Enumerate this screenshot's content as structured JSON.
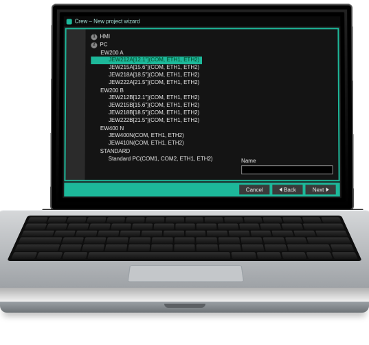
{
  "window": {
    "title": "Crew – New project wizard"
  },
  "steps": [
    {
      "num": "1",
      "label": "HMI"
    },
    {
      "num": "2",
      "label": "PC"
    }
  ],
  "tree": [
    {
      "group": "EW200 A",
      "items": [
        "JEW212A[12.1\"](COM, ETH1, ETH2)",
        "JEW215A[15.6\"](COM, ETH1, ETH2)",
        "JEW218A[18.5\"](COM, ETH1, ETH2)",
        "JEW222A[21.5\"](COM, ETH1, ETH2)"
      ],
      "selected": 0
    },
    {
      "group": "EW200 B",
      "items": [
        "JEW212B[12.1\"](COM, ETH1, ETH2)",
        "JEW215B[15.6\"](COM, ETH1, ETH2)",
        "JEW218B[18.5\"](COM, ETH1, ETH2)",
        "JEW222B[21.5\"](COM, ETH1, ETH2)"
      ]
    },
    {
      "group": "EW400 N",
      "items": [
        "JEW400N(COM, ETH1, ETH2)",
        "JEW410N(COM, ETH1, ETH2)"
      ]
    },
    {
      "group": "STANDARD",
      "items": [
        "Standard PC(COM1, COM2, ETH1, ETH2)"
      ]
    }
  ],
  "namePanel": {
    "label": "Name",
    "value": ""
  },
  "buttons": {
    "cancel": "Cancel",
    "back": "Back",
    "next": "Next"
  }
}
